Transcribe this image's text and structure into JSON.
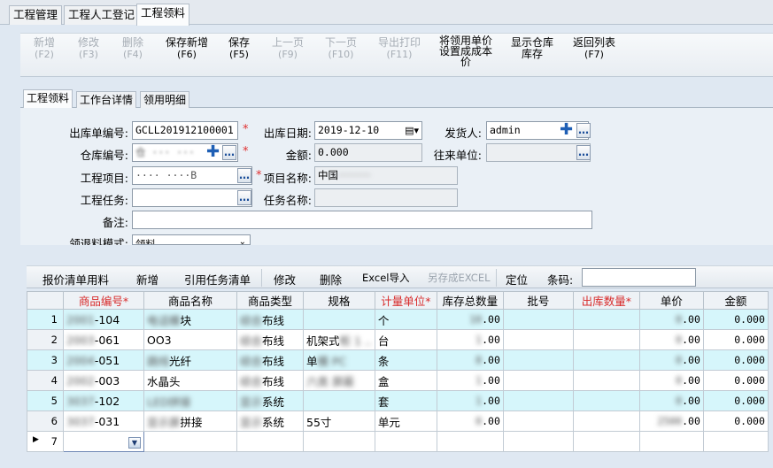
{
  "top_tabs": [
    {
      "label": "工程管理",
      "active": false
    },
    {
      "label": "工程人工登记",
      "active": false
    },
    {
      "label": "工程领料",
      "active": true
    }
  ],
  "toolbar": {
    "new": {
      "label": "新增",
      "key": "(F2)",
      "enabled": false
    },
    "modify": {
      "label": "修改",
      "key": "(F3)",
      "enabled": false
    },
    "delete": {
      "label": "删除",
      "key": "(F4)",
      "enabled": false
    },
    "save_new": {
      "label": "保存新增",
      "key": "(F6)",
      "enabled": true
    },
    "save": {
      "label": "保存",
      "key": "(F5)",
      "enabled": true
    },
    "prev": {
      "label": "上一页",
      "key": "(F9)",
      "enabled": false
    },
    "next": {
      "label": "下一页",
      "key": "(F10)",
      "enabled": false
    },
    "export_print": {
      "label": "导出打印",
      "key": "(F11)",
      "enabled": false
    },
    "set_cost": {
      "line1": "将领用单价",
      "line2": "设置成成本",
      "line3": "价",
      "enabled": true
    },
    "show_stock": {
      "line1": "显示仓库",
      "line2": "库存",
      "enabled": true
    },
    "back_list": {
      "label": "返回列表",
      "key": "(F7)",
      "enabled": true
    }
  },
  "sub_tabs": [
    {
      "label": "工程领料",
      "active": true
    },
    {
      "label": "工作台详情",
      "active": false
    },
    {
      "label": "领用明细",
      "active": false
    }
  ],
  "form": {
    "out_no_label": "出库单编号:",
    "out_no_value": "GCLL201912100001",
    "out_date_label": "出库日期:",
    "out_date_value": "2019-12-10",
    "sender_label": "发货人:",
    "sender_value": "admin",
    "warehouse_label": "仓库编号:",
    "warehouse_value": "仓 ··· ···",
    "amount_label": "金额:",
    "amount_value": "0.000",
    "partner_label": "往来单位:",
    "partner_value": "",
    "project_label": "工程项目:",
    "project_value": "···· ····B",
    "project_name_label": "项目名称:",
    "project_name_value": "中国",
    "project_name_rest": "··········",
    "task_label": "工程任务:",
    "task_value": "",
    "task_name_label": "任务名称:",
    "task_name_value": "",
    "remark_label": "备注:",
    "remark_value": "",
    "mode_label": "领退料模式:",
    "mode_value": "领料"
  },
  "grid_toolbar": {
    "quote_list": "报价清单用料",
    "add": "新增",
    "ref_task": "引用任务清单",
    "modify": "修改",
    "delete": "删除",
    "excel_import": "Excel导入",
    "save_excel": "另存成EXCEL",
    "locate": "定位",
    "barcode_label": "条码:",
    "barcode_value": ""
  },
  "grid": {
    "columns": [
      "商品编号*",
      "商品名称",
      "商品类型",
      "规格",
      "计量单位*",
      "库存总数量",
      "批号",
      "出库数量*",
      "单价",
      "金额"
    ],
    "rows": [
      {
        "no": "1",
        "code_hidden": "2001",
        "code": "-104",
        "name_hidden": "电话模",
        "name": "块",
        "type_hidden": "综合",
        "type": "布线",
        "spec_hidden": "",
        "spec": "",
        "unit": "个",
        "stock_hidden": "10",
        "stock": ".00",
        "batch": "",
        "qty": "",
        "price_hidden": "0",
        "price": ".00",
        "amount": "0.000"
      },
      {
        "no": "2",
        "code_hidden": "2003",
        "code": "-061",
        "name_hidden": "",
        "name": "OO3",
        "type_hidden": "综合",
        "type": "布线",
        "spec_hidden": "柜 1 ..",
        "spec": "机架式",
        "unit": "台",
        "stock_hidden": "1",
        "stock": ".00",
        "batch": "",
        "qty": "",
        "price_hidden": "0",
        "price": ".00",
        "amount": "0.000"
      },
      {
        "no": "3",
        "code_hidden": "2004",
        "code": "-051",
        "name_hidden": "跳线",
        "name": "光纤",
        "type_hidden": "综合",
        "type": "布线",
        "spec_hidden": "模 PC",
        "spec": "单",
        "unit": "条",
        "stock_hidden": "8",
        "stock": ".00",
        "batch": "",
        "qty": "",
        "price_hidden": "0",
        "price": ".00",
        "amount": "0.000"
      },
      {
        "no": "4",
        "code_hidden": "2002",
        "code": "-003",
        "name_hidden": "",
        "name": "水晶头",
        "type_hidden": "综合",
        "type": "布线",
        "spec_hidden": "六类 屏蔽",
        "spec": "",
        "unit": "盒",
        "stock_hidden": "1",
        "stock": ".00",
        "batch": "",
        "qty": "",
        "price_hidden": "0",
        "price": ".00",
        "amount": "0.000"
      },
      {
        "no": "5",
        "code_hidden": "3037",
        "code": "-102",
        "name_hidden": "LED拼接",
        "name": "",
        "type_hidden": "显示",
        "type": "系统",
        "spec_hidden": "",
        "spec": "",
        "unit": "套",
        "stock_hidden": "1",
        "stock": ".00",
        "batch": "",
        "qty": "",
        "price_hidden": "0",
        "price": ".00",
        "amount": "0.000"
      },
      {
        "no": "6",
        "code_hidden": "3037",
        "code": "-031",
        "name_hidden": "显示屏",
        "name": "拼接",
        "type_hidden": "显示",
        "type": "系统",
        "spec_hidden": "",
        "spec": "55寸",
        "unit": "单元",
        "stock_hidden": "0",
        "stock": ".00",
        "batch": "",
        "qty": "",
        "price_hidden": "2500",
        "price": ".00",
        "amount": "0.000"
      }
    ],
    "new_row_no": "7"
  }
}
